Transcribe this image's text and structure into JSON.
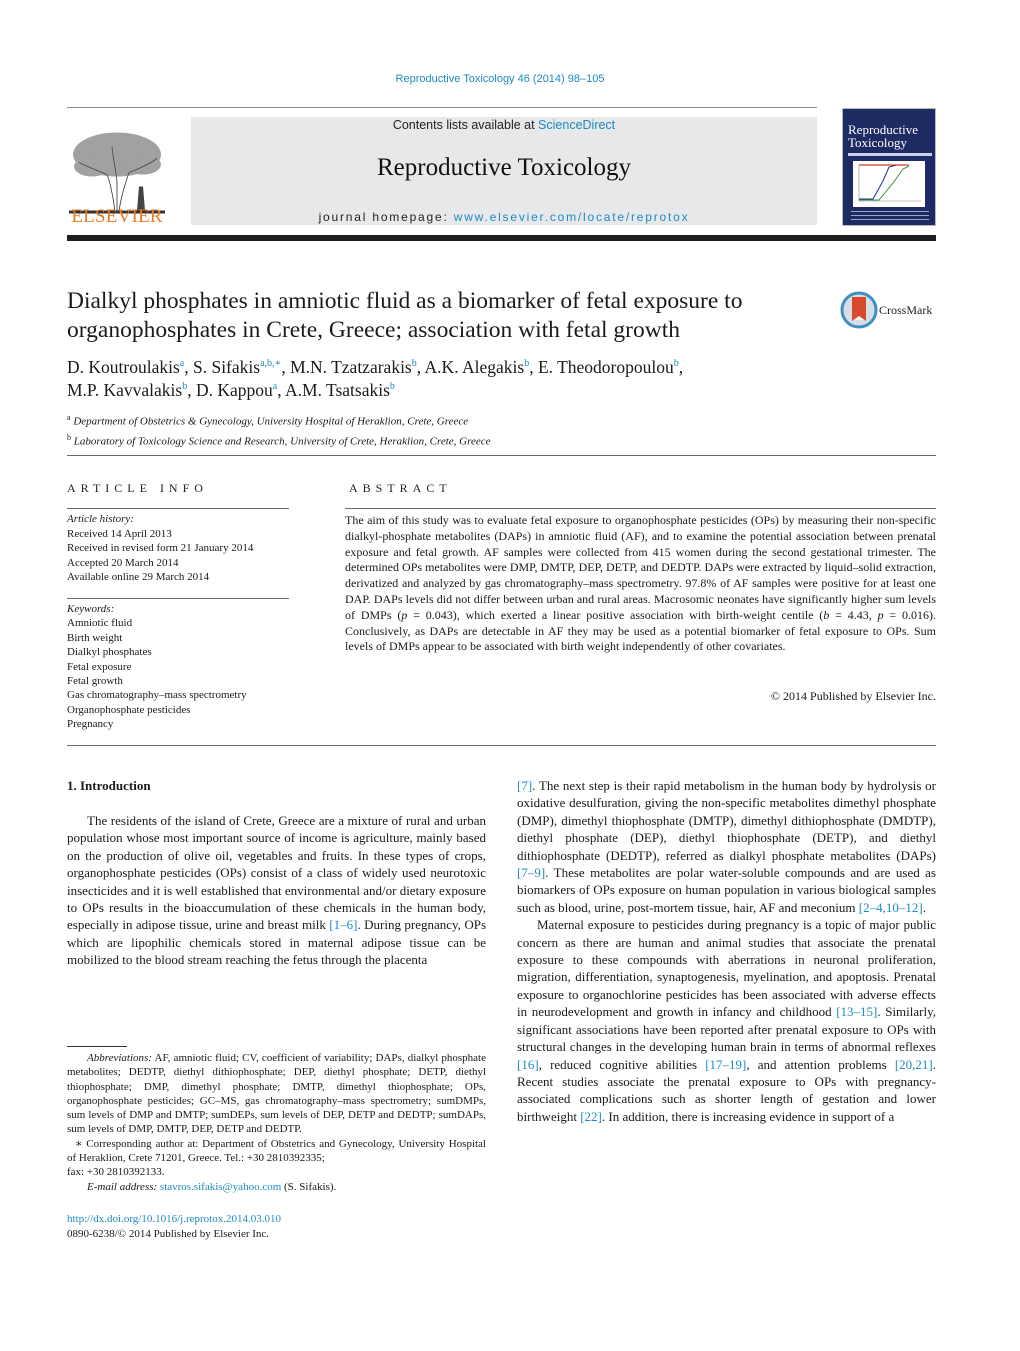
{
  "header": {
    "citation": "Reproductive Toxicology 46 (2014) 98–105",
    "contents_prefix": "Contents lists available at ",
    "contents_link": "ScienceDirect",
    "journal_title": "Reproductive Toxicology",
    "homepage_prefix": "journal homepage: ",
    "homepage_link": "www.elsevier.com/locate/reprotox",
    "publisher_logo_text": "ELSEVIER",
    "cover_title_line1": "Reproductive",
    "cover_title_line2": "Toxicology",
    "colors": {
      "link": "#1f8ac0",
      "elsevier_orange": "#f07a1e",
      "cover_blue": "#1e2b63",
      "banner_gray": "#e7e8ea"
    }
  },
  "article": {
    "title": "Dialkyl phosphates in amniotic fluid as a biomarker of fetal exposure to organophosphates in Crete, Greece; association with fetal growth",
    "crossmark_label": "CrossMark",
    "authors": [
      {
        "name": "D. Koutroulakis",
        "aff": "a"
      },
      {
        "name": "S. Sifakis",
        "aff": "a,b,∗"
      },
      {
        "name": "M.N. Tzatzarakis",
        "aff": "b"
      },
      {
        "name": "A.K. Alegakis",
        "aff": "b"
      },
      {
        "name": "E. Theodoropoulou",
        "aff": "b"
      },
      {
        "name": "M.P. Kavvalakis",
        "aff": "b"
      },
      {
        "name": "D. Kappou",
        "aff": "a"
      },
      {
        "name": "A.M. Tsatsakis",
        "aff": "b"
      }
    ],
    "affiliations": [
      {
        "key": "a",
        "text": "Department of Obstetrics & Gynecology, University Hospital of Heraklion, Crete, Greece"
      },
      {
        "key": "b",
        "text": "Laboratory of Toxicology Science and Research, University of Crete, Heraklion, Crete, Greece"
      }
    ]
  },
  "article_info": {
    "heading": "ARTICLE INFO",
    "history_label": "Article history:",
    "history": [
      "Received 14 April 2013",
      "Received in revised form 21 January 2014",
      "Accepted 20 March 2014",
      "Available online 29 March 2014"
    ],
    "keywords_label": "Keywords:",
    "keywords": [
      "Amniotic fluid",
      "Birth weight",
      "Dialkyl phosphates",
      "Fetal exposure",
      "Fetal growth",
      "Gas chromatography–mass spectrometry",
      "Organophosphate pesticides",
      "Pregnancy"
    ]
  },
  "abstract": {
    "heading": "ABSTRACT",
    "text_part1": "The aim of this study was to evaluate fetal exposure to organophosphate pesticides (OPs) by measuring their non-specific dialkyl-phosphate metabolites (DAPs) in amniotic fluid (AF), and to examine the potential association between prenatal exposure and fetal growth. AF samples were collected from 415 women during the second gestational trimester. The determined OPs metabolites were DMP, DMTP, DEP, DETP, and DEDTP. DAPs were extracted by liquid–solid extraction, derivatized and analyzed by gas chromatography–mass spectrometry. 97.8% of AF samples were positive for at least one DAP. DAPs levels did not differ between urban and rural areas. Macrosomic neonates have significantly higher sum levels of DMPs (",
    "p1_var": "p",
    "p1_val": " = 0.043), which exerted a linear positive association with birth-weight centile (",
    "b_var": "b",
    "b_val": " = 4.43, ",
    "p2_var": "p",
    "text_part2": " = 0.016). Conclusively, as DAPs are detectable in AF they may be used as a potential biomarker of fetal exposure to OPs. Sum levels of DMPs appear to be associated with birth weight independently of other covariates.",
    "copyright": "© 2014 Published by Elsevier Inc."
  },
  "body": {
    "section_heading": "1.  Introduction",
    "left_para_a": "The residents of the island of Crete, Greece are a mixture of rural and urban population whose most important source of income is agriculture, mainly based on the production of olive oil, vegetables and fruits. In these types of crops, organophosphate pesticides (OPs) consist of a class of widely used neurotoxic insecticides and it is well established that environmental and/or dietary exposure to OPs results in the bioaccumulation of these chemicals in the human body, especially in adipose tissue, urine and breast milk ",
    "ref_1_6": "[1–6]",
    "left_para_b": ". During pregnancy, OPs which are lipophilic chemicals stored in maternal adipose tissue can be mobilized to the blood stream reaching the fetus through the placenta",
    "ref_7": "[7]",
    "right_para1_a": ". The next step is their rapid metabolism in the human body by hydrolysis or oxidative desulfuration, giving the non-specific metabolites dimethyl phosphate (DMP), dimethyl thiophosphate (DMTP), dimethyl dithiophosphate (DMDTP), diethyl phosphate (DEP), diethyl thiophosphate (DETP), and diethyl dithiophosphate (DEDTP), referred as dialkyl phosphate metabolites (DAPs) ",
    "ref_7_9": "[7–9]",
    "right_para1_b": ". These metabolites are polar water-soluble compounds and are used as biomarkers of OPs exposure on human population in various biological samples such as blood, urine, post-mortem tissue, hair, AF and meconium ",
    "ref_2_12": "[2–4,10–12]",
    "right_para1_c": ".",
    "right_para2_a": "Maternal exposure to pesticides during pregnancy is a topic of major public concern as there are human and animal studies that associate the prenatal exposure to these compounds with aberrations in neuronal proliferation, migration, differentiation, synaptogenesis, myelination, and apoptosis. Prenatal exposure to organochlorine pesticides has been associated with adverse effects in neurodevelopment and growth in infancy and childhood ",
    "ref_13_15": "[13–15]",
    "right_para2_b": ". Similarly, significant associations have been reported after prenatal exposure to OPs with structural changes in the developing human brain in terms of abnormal reflexes ",
    "ref_16": "[16]",
    "right_para2_c": ", reduced cognitive abilities ",
    "ref_17_19": "[17–19]",
    "right_para2_d": ", and attention problems ",
    "ref_20_21": "[20,21]",
    "right_para2_e": ". Recent studies associate the prenatal exposure to OPs with pregnancy-associated complications such as shorter length of gestation and lower birthweight ",
    "ref_22": "[22]",
    "right_para2_f": ". In addition, there is increasing evidence in support of a"
  },
  "footnotes": {
    "abbrev_label": "Abbreviations:",
    "abbrev_text": " AF, amniotic fluid; CV, coefficient of variability; DAPs, dialkyl phosphate metabolites; DEDTP, diethyl dithiophosphate; DEP, diethyl phosphate; DETP, diethyl thiophosphate; DMP, dimethyl phosphate; DMTP, dimethyl thiophosphate; OPs, organophosphate pesticides; GC–MS, gas chromatography–mass spectrometry; sumDMPs, sum levels of DMP and DMTP; sumDEPs, sum levels of DEP, DETP and DEDTP; sumDAPs, sum levels of DMP, DMTP, DEP, DETP and DEDTP.",
    "corresponding": "∗ Corresponding author at: Department of Obstetrics and Gynecology, University Hospital of Heraklion, Crete 71201, Greece. Tel.: +30 2810392335;",
    "fax": "fax: +30 2810392133.",
    "email_label": "E-mail address:",
    "email": "stavros.sifakis@yahoo.com",
    "email_suffix": " (S. Sifakis).",
    "doi": "http://dx.doi.org/10.1016/j.reprotox.2014.03.010",
    "issn_line": "0890-6238/© 2014 Published by Elsevier Inc."
  }
}
